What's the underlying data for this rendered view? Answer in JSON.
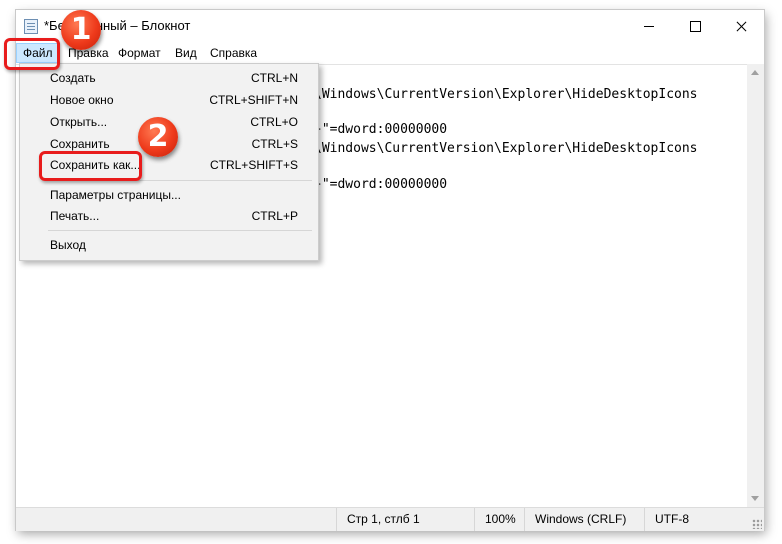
{
  "window": {
    "title": "*Безымянный – Блокнот",
    "app_icon": "notepad-icon",
    "controls": {
      "minimize": "minimize-icon",
      "maximize": "maximize-icon",
      "close": "close-icon"
    }
  },
  "menubar": {
    "file": "Файл",
    "edit": "Правка",
    "format": "Формат",
    "view": "Вид",
    "help": "Справка"
  },
  "editor": {
    "lines": [
      "\\Windows\\CurrentVersion\\Explorer\\HideDesktopIcons",
      "}\"=dword:00000000",
      "\\Windows\\CurrentVersion\\Explorer\\HideDesktopIcons",
      "}\"=dword:00000000"
    ]
  },
  "file_menu": {
    "items": [
      {
        "label": "Создать",
        "shortcut": "CTRL+N"
      },
      {
        "label": "Новое окно",
        "shortcut": "CTRL+SHIFT+N"
      },
      {
        "label": "Открыть...",
        "shortcut": "CTRL+O"
      },
      {
        "label": "Сохранить",
        "shortcut": "CTRL+S"
      },
      {
        "label": "Сохранить как...",
        "shortcut": "CTRL+SHIFT+S"
      },
      {
        "label": "Параметры страницы...",
        "shortcut": ""
      },
      {
        "label": "Печать...",
        "shortcut": "CTRL+P"
      },
      {
        "label": "Выход",
        "shortcut": ""
      }
    ]
  },
  "statusbar": {
    "position": "Стр 1, стлб 1",
    "zoom": "100%",
    "line_ending": "Windows (CRLF)",
    "encoding": "UTF-8"
  },
  "annotations": {
    "step1": "1",
    "step2": "2",
    "color": "#e81c1c"
  },
  "colors": {
    "menu_highlight": "#cce8ff",
    "menu_background": "#f2f2f2",
    "statusbar": "#f0f0f0"
  }
}
